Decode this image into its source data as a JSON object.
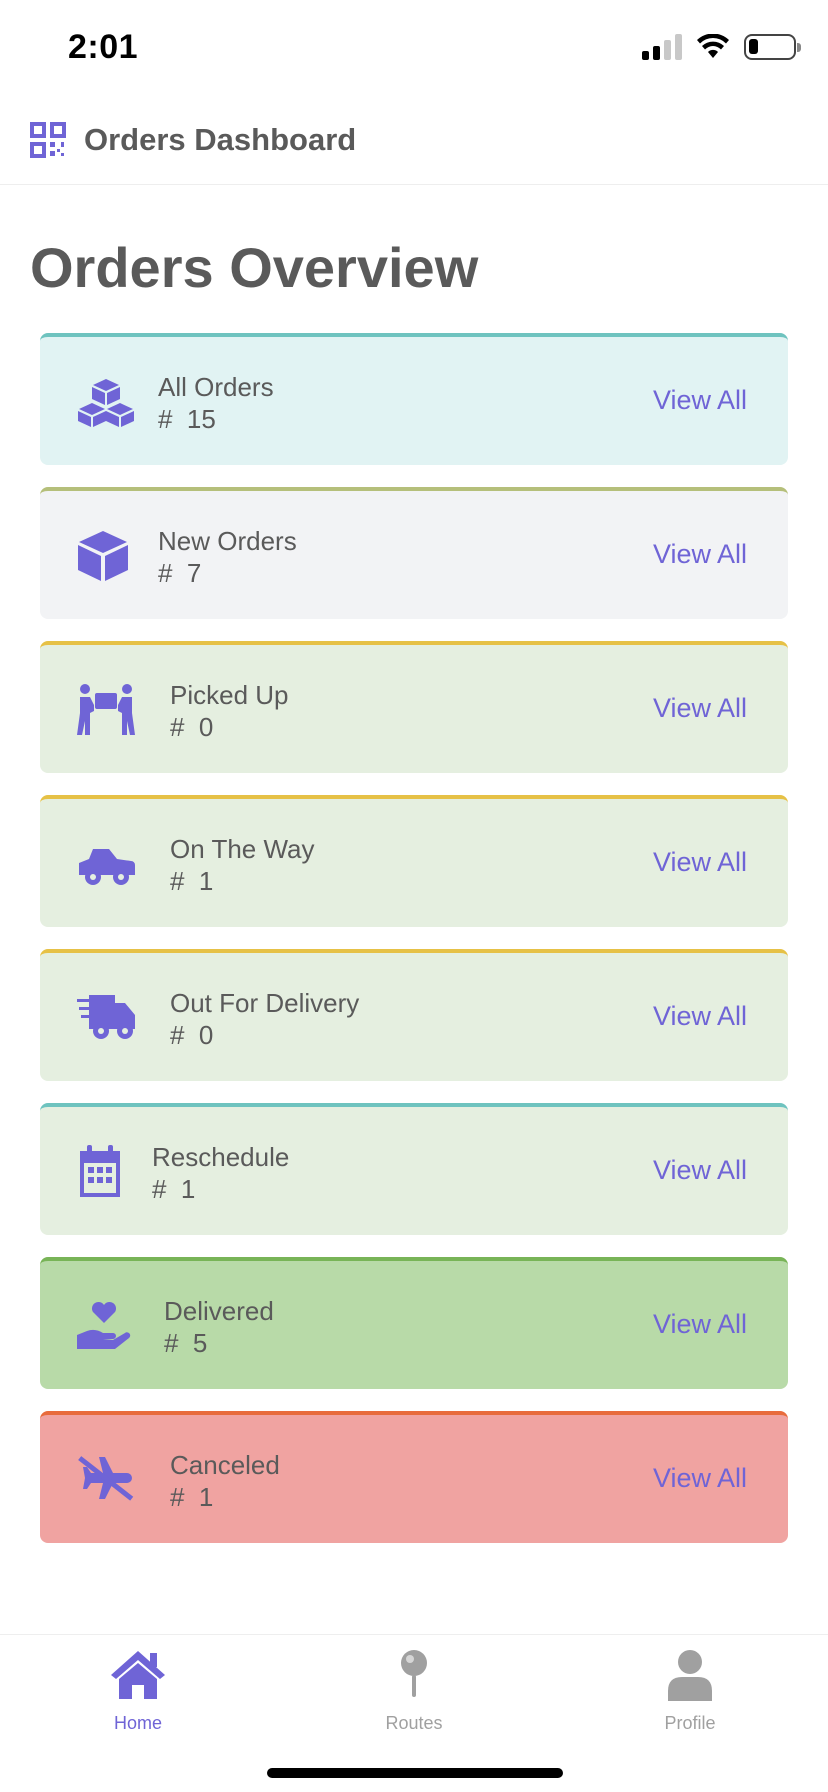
{
  "status_bar": {
    "time": "2:01"
  },
  "header": {
    "title": "Orders Dashboard",
    "icon": "qr-code-icon"
  },
  "page_title": "Orders Overview",
  "colors": {
    "accent": "#6f64d6",
    "text": "#5a5a5a"
  },
  "cards": [
    {
      "title": "All Orders",
      "count": "#  15",
      "link": "View All",
      "icon": "cubes-icon",
      "bg": "#e1f3f3",
      "border": "#6ec3bf"
    },
    {
      "title": "New Orders",
      "count": "#  7",
      "link": "View All",
      "icon": "box-icon",
      "bg": "#f2f3f5",
      "border": "#b5bf7a"
    },
    {
      "title": "Picked Up",
      "count": "#  0",
      "link": "View All",
      "icon": "people-carry-icon",
      "bg": "#e5efe0",
      "border": "#e6c146"
    },
    {
      "title": "On The Way",
      "count": "#  1",
      "link": "View All",
      "icon": "truck-pickup-icon",
      "bg": "#e5efe0",
      "border": "#e6c146"
    },
    {
      "title": "Out For Delivery",
      "count": "#  0",
      "link": "View All",
      "icon": "shipping-fast-icon",
      "bg": "#e5efe0",
      "border": "#e6c146"
    },
    {
      "title": "Reschedule",
      "count": "#  1",
      "link": "View All",
      "icon": "calendar-icon",
      "bg": "#e5efe0",
      "border": "#6ec3bf"
    },
    {
      "title": "Delivered",
      "count": "#  5",
      "link": "View All",
      "icon": "hand-holding-heart-icon",
      "bg": "#b8daa8",
      "border": "#78b457"
    },
    {
      "title": "Canceled",
      "count": "#  1",
      "link": "View All",
      "icon": "plane-slash-icon",
      "bg": "#f0a3a1",
      "border": "#e86b3c"
    }
  ],
  "tabs": [
    {
      "label": "Home",
      "icon": "home-icon",
      "active": true
    },
    {
      "label": "Routes",
      "icon": "map-pin-icon",
      "active": false
    },
    {
      "label": "Profile",
      "icon": "user-icon",
      "active": false
    }
  ]
}
